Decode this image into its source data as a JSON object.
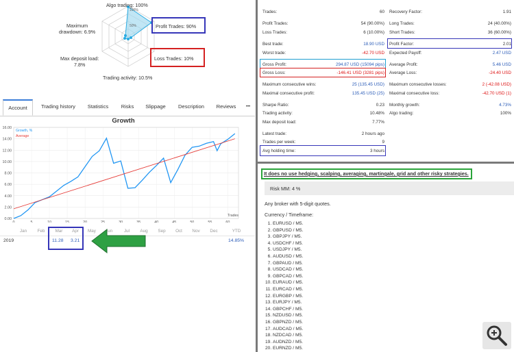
{
  "radar": {
    "algo_trading": "Algo trading: 100%",
    "profit_trades": "Profit Trades: 90%",
    "loss_trades": "Loss Trades: 10%",
    "trading_activity": "Trading activity: 10.5%",
    "max_deposit_load": [
      "Max deposit load:",
      "7.8%"
    ],
    "max_drawdown": [
      "Maximum",
      "drawdown: 6.9%"
    ],
    "ring_labels": [
      "100%",
      "50%"
    ],
    "values": {
      "algo_trading": 1.0,
      "profit_trades": 0.9,
      "loss_trades": 0.1,
      "trading_activity": 0.105,
      "max_deposit_load": 0.078,
      "max_drawdown": 0.069
    }
  },
  "tabs": [
    "Account",
    "Trading history",
    "Statistics",
    "Risks",
    "Slippage",
    "Description",
    "Reviews",
    "•••"
  ],
  "chart_data": {
    "type": "line",
    "title": "Growth",
    "xlabel": "Trades",
    "ylabel": "",
    "x_ticks": [
      "0",
      "5",
      "10",
      "15",
      "20",
      "25",
      "30",
      "35",
      "40",
      "45",
      "50",
      "55",
      "60"
    ],
    "y_ticks": [
      "0.00",
      "2.00",
      "4.00",
      "6.00",
      "8.00",
      "10.00",
      "12.00",
      "14.00",
      "16.00"
    ],
    "ylim": [
      0,
      16
    ],
    "xlim": [
      0,
      63
    ],
    "legend": "top-left",
    "series": [
      {
        "name": "Growth, %",
        "color": "#2196f3",
        "x": [
          0,
          2,
          4,
          6,
          8,
          10,
          12,
          14,
          16,
          18,
          20,
          22,
          24,
          26,
          28,
          30,
          32,
          34,
          36,
          38,
          40,
          42,
          44,
          46,
          48,
          50,
          52,
          54,
          56,
          57,
          58,
          60,
          62
        ],
        "y": [
          0,
          0.5,
          1.5,
          2.8,
          3.3,
          3.8,
          4.8,
          5.8,
          6.5,
          7.3,
          9.1,
          10.9,
          11.9,
          14.1,
          9.7,
          10.1,
          5.3,
          5.4,
          6.7,
          8.1,
          9.3,
          10.6,
          6.3,
          8.6,
          11.1,
          12.5,
          12.7,
          13.2,
          13.5,
          11.9,
          13.1,
          13.9,
          14.9
        ]
      },
      {
        "name": "Average",
        "color": "#e53935",
        "x": [
          0,
          62
        ],
        "y": [
          1.7,
          14.0
        ]
      }
    ]
  },
  "calendar": {
    "months": [
      "Jan",
      "Feb",
      "Mar",
      "Apr",
      "May",
      "Jun",
      "Jul",
      "Aug",
      "Sep",
      "Oct",
      "Nov",
      "Dec",
      "YTD"
    ],
    "year": "2019",
    "mar": "11.28",
    "apr": "3.21",
    "ytd": "14.85%"
  },
  "stats_left": [
    {
      "k": "Trades:",
      "v": "60"
    },
    {
      "k": "Profit Trades:",
      "v": "54 (90.00%)"
    },
    {
      "k": "Loss Trades:",
      "v": "6 (10.00%)"
    },
    {
      "k": "Best trade:",
      "v": "18.90 USD",
      "c": "blue"
    },
    {
      "k": "Worst trade:",
      "v": "-42.70 USD",
      "c": "red"
    },
    {
      "k": "Gross Profit:",
      "v": "294.87 USD (15094 pips)",
      "c": "blue"
    },
    {
      "k": "Gross Loss:",
      "v": "-146.41 USD (3281 pips)",
      "c": "red"
    },
    {
      "k": "Maximum consecutive wins:",
      "v": "25 (135.45 USD)",
      "c": "blue"
    },
    {
      "k": "Maximal consecutive profit:",
      "v": "135.45 USD (25)",
      "c": "blue"
    },
    {
      "k": "Sharpe Ratio:",
      "v": "0.23"
    },
    {
      "k": "Trading activity:",
      "v": "10.48%"
    },
    {
      "k": "Max deposit load:",
      "v": "7.77%"
    },
    {
      "k": "Latest trade:",
      "v": "2 hours ago"
    },
    {
      "k": "Trades per week:",
      "v": "9"
    },
    {
      "k": "Avg holding time:",
      "v": "3 hours"
    }
  ],
  "stats_right": [
    {
      "k": "Recovery Factor:",
      "v": "1.91"
    },
    {
      "k": "Long Trades:",
      "v": "24 (40.00%)"
    },
    {
      "k": "Short Trades:",
      "v": "36 (60.00%)"
    },
    {
      "k": "Profit Factor:",
      "v": "2.01"
    },
    {
      "k": "Expected Payoff:",
      "v": "2.47 USD",
      "c": "blue"
    },
    {
      "k": "Average Profit:",
      "v": "5.46 USD",
      "c": "blue"
    },
    {
      "k": "Average Loss:",
      "v": "-24.40 USD",
      "c": "red"
    },
    {
      "k": "Maximum consecutive losses:",
      "v": "2 (-42.08 USD)",
      "c": "red"
    },
    {
      "k": "Maximal consecutive loss:",
      "v": "-42.70 USD (1)",
      "c": "red"
    },
    {
      "k": "Monthly growth:",
      "v": "4.73%",
      "c": "blue"
    },
    {
      "k": "Algo trading:",
      "v": "100%"
    }
  ],
  "description": {
    "headline": "It does no use hedging, scalping, averaging, martingale, grid and other risky strategies.",
    "risk": "Risk MM: 4 %",
    "broker": "Any broker with 5-digit quotes.",
    "currency_title": "Currency / Timeframe:",
    "pairs": [
      "EURUSD / M5.",
      "GBPUSD / M5.",
      "GBPJPY / M5.",
      "USDCHF / M5.",
      "USDJPY / M5.",
      "AUDUSD / M5.",
      "GBPAUD / M5.",
      "USDCAD / M5.",
      "GBPCAD / M5.",
      "EURAUD / M5.",
      "EURCAD / M5.",
      "EURGBP / M5.",
      "EURJPY / M5.",
      "GBPCHF / M5.",
      "NZDUSD / M5.",
      "GBPNZD / M5.",
      "AUDCAD / M5.",
      "NZDCAD / M5.",
      "AUDNZD / M5.",
      "EURNZD / M5."
    ]
  },
  "colors": {
    "blue_box": "#3535b8",
    "red_box": "#d42020",
    "cyan_box": "#1f9fd1",
    "green_box": "#2aa33a",
    "accent": "#2b5cb8"
  }
}
